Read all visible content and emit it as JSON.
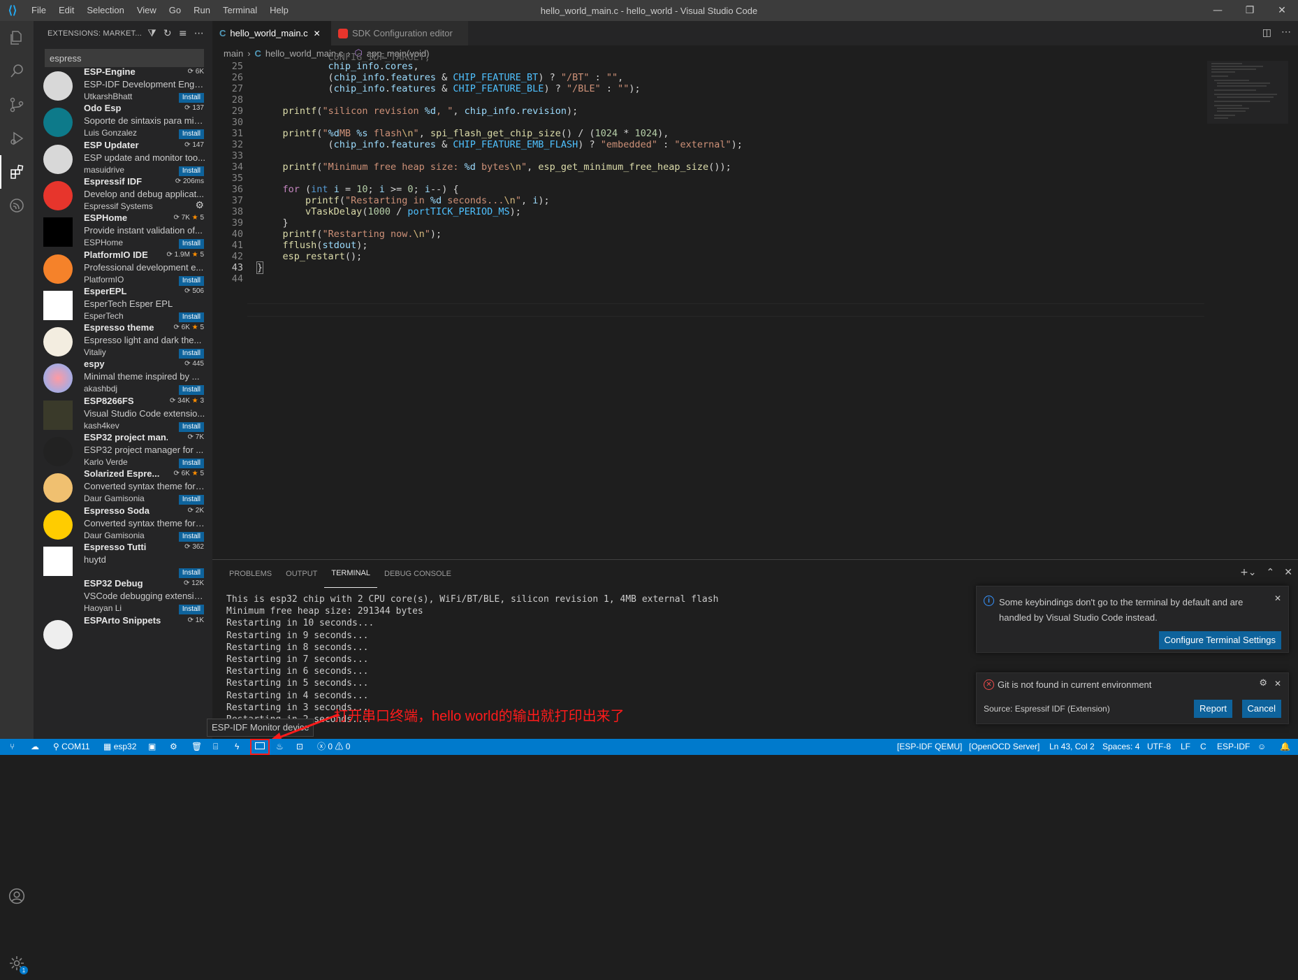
{
  "titlebar": {
    "menu": [
      "File",
      "Edit",
      "Selection",
      "View",
      "Go",
      "Run",
      "Terminal",
      "Help"
    ],
    "title": "hello_world_main.c - hello_world - Visual Studio Code"
  },
  "sidebar": {
    "header": "EXTENSIONS: MARKET...",
    "search_value": "espress",
    "extensions": [
      {
        "name": "ESP-Engine",
        "stats": "6K",
        "desc": "ESP-IDF Development Engin...",
        "author": "UtkarshBhatt",
        "action": "Install",
        "icon": "esp-engine-icon"
      },
      {
        "name": "Odo Esp",
        "stats": "137",
        "desc": "Soporte de sintaxis para mi l...",
        "author": "Luis Gonzalez",
        "action": "Install",
        "icon": "odo-esp-icon"
      },
      {
        "name": "ESP Updater",
        "stats": "147",
        "desc": "ESP update and monitor too...",
        "author": "masuidrive",
        "action": "Install",
        "icon": "esp-updater-icon"
      },
      {
        "name": "Espressif IDF",
        "stats": "206ms",
        "desc": "Develop and debug applicat...",
        "author": "Espressif Systems",
        "action": "",
        "icon": "espressif-idf-icon"
      },
      {
        "name": "ESPHome",
        "stats": "7K",
        "rating": "5",
        "desc": "Provide instant validation of...",
        "author": "ESPHome",
        "action": "Install",
        "icon": "esphome-icon"
      },
      {
        "name": "PlatformIO IDE",
        "stats": "1.9M",
        "rating": "5",
        "desc": "Professional development e...",
        "author": "PlatformIO",
        "action": "Install",
        "icon": "platformio-icon"
      },
      {
        "name": "EsperEPL",
        "stats": "506",
        "desc": "EsperTech Esper EPL",
        "author": "EsperTech",
        "action": "Install",
        "icon": "esper-icon"
      },
      {
        "name": "Espresso theme",
        "stats": "6K",
        "rating": "5",
        "desc": "Espresso light and dark the...",
        "author": "Vitaliy",
        "action": "Install",
        "icon": "espresso-theme-icon"
      },
      {
        "name": "espy",
        "stats": "445",
        "desc": "Minimal theme inspired by ...",
        "author": "akashbdj",
        "action": "Install",
        "icon": "espy-icon"
      },
      {
        "name": "ESP8266FS",
        "stats": "34K",
        "rating": "3",
        "desc": "Visual Studio Code extensio...",
        "author": "kash4kev",
        "action": "Install",
        "icon": "esp8266fs-icon"
      },
      {
        "name": "ESP32 project man...",
        "stats": "7K",
        "desc": "ESP32 project manager for ...",
        "author": "Karlo Verde",
        "action": "Install",
        "icon": "esp32-project-icon"
      },
      {
        "name": "Solarized Espre...",
        "stats": "6K",
        "rating": "5",
        "desc": "Converted syntax theme for ...",
        "author": "Daur Gamisonia",
        "action": "Install",
        "icon": "solarized-espresso-icon"
      },
      {
        "name": "Espresso Soda",
        "stats": "2K",
        "desc": "Converted syntax theme for ...",
        "author": "Daur Gamisonia",
        "action": "Install",
        "icon": "espresso-soda-icon"
      },
      {
        "name": "Espresso Tutti",
        "stats": "362",
        "desc": "huytd",
        "author": "",
        "action": "Install",
        "icon": "espresso-tutti-icon"
      },
      {
        "name": "ESP32 Debug",
        "stats": "12K",
        "desc": "VSCode debugging extensio...",
        "author": "Haoyan Li",
        "action": "Install",
        "icon": "esp32-debug-icon"
      },
      {
        "name": "ESPArto Snippets",
        "stats": "1K",
        "desc": "",
        "author": "",
        "action": "",
        "icon": "esparto-icon"
      }
    ]
  },
  "tabs": [
    {
      "label": "hello_world_main.c",
      "icon": "C"
    },
    {
      "label": "SDK Configuration editor"
    }
  ],
  "breadcrumb": [
    "main",
    "hello_world_main.c",
    "app_main(void)"
  ],
  "editor": {
    "line_numbers": [
      "25",
      "26",
      "27",
      "28",
      "29",
      "30",
      "31",
      "32",
      "33",
      "34",
      "35",
      "36",
      "37",
      "38",
      "39",
      "40",
      "41",
      "42",
      "43",
      "44"
    ],
    "top_partial": "            CONFIG_IDF_TARGET,"
  },
  "panel": {
    "tabs": [
      "PROBLEMS",
      "OUTPUT",
      "TERMINAL",
      "DEBUG CONSOLE"
    ],
    "terminal_lines": [
      "This is esp32 chip with 2 CPU core(s), WiFi/BT/BLE, silicon revision 1, 4MB external flash",
      "Minimum free heap size: 291344 bytes",
      "Restarting in 10 seconds...",
      "Restarting in 9 seconds...",
      "Restarting in 8 seconds...",
      "Restarting in 7 seconds...",
      "Restarting in 6 seconds...",
      "Restarting in 5 seconds...",
      "Restarting in 4 seconds...",
      "Restarting in 3 seconds...",
      "Restarting in 2 seconds..."
    ]
  },
  "notifications": {
    "n1_text": "Some keybindings don't go to the terminal by default and are handled by Visual Studio Code instead.",
    "n1_button": "Configure Terminal Settings",
    "n2_text": "Git is not found in current environment",
    "n2_source": "Source: Espressif IDF (Extension)",
    "n2_report": "Report",
    "n2_cancel": "Cancel"
  },
  "tooltip": "ESP-IDF Monitor device",
  "annotation": "打开串口终端，hello world的输出就打印出来了",
  "statusbar": {
    "port": "COM11",
    "target": "esp32",
    "problems": "0",
    "warnings": "0",
    "qemu": "[ESP-IDF QEMU]",
    "openocd": "[OpenOCD Server]",
    "position": "Ln 43, Col 2",
    "spaces": "Spaces: 4",
    "encoding": "UTF-8",
    "eol": "LF",
    "language": "C",
    "idf": "ESP-IDF"
  },
  "colors": {
    "accent": "#007acc",
    "button": "#0e639c",
    "annotation": "#ff1b1b"
  }
}
